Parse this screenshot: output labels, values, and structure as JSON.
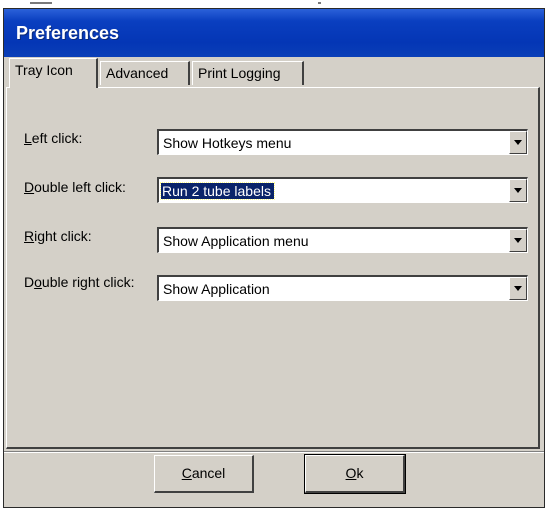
{
  "window": {
    "title": "Preferences"
  },
  "tabs": [
    {
      "label": "Tray Icon",
      "active": true
    },
    {
      "label": "Advanced",
      "active": false
    },
    {
      "label": "Print Logging",
      "active": false
    }
  ],
  "settings": [
    {
      "label_accel": "L",
      "label_rest": "eft click:",
      "value": "Show Hotkeys menu",
      "selected": false
    },
    {
      "label_accel": "D",
      "label_rest": "ouble left click:",
      "value": "Run 2 tube labels",
      "selected": true
    },
    {
      "label_accel": "R",
      "label_rest": "ight click:",
      "value": "Show Application menu",
      "selected": false
    },
    {
      "label_pre": "D",
      "label_accel": "o",
      "label_rest": "uble right click:",
      "value": "Show Application",
      "selected": false
    }
  ],
  "buttons": {
    "cancel_accel": "C",
    "cancel_rest": "ancel",
    "ok_accel": "O",
    "ok_rest": "k"
  },
  "colors": {
    "titlebar": "#0436b5",
    "dialog_bg": "#d4d0c8",
    "selection": "#0a246a"
  }
}
